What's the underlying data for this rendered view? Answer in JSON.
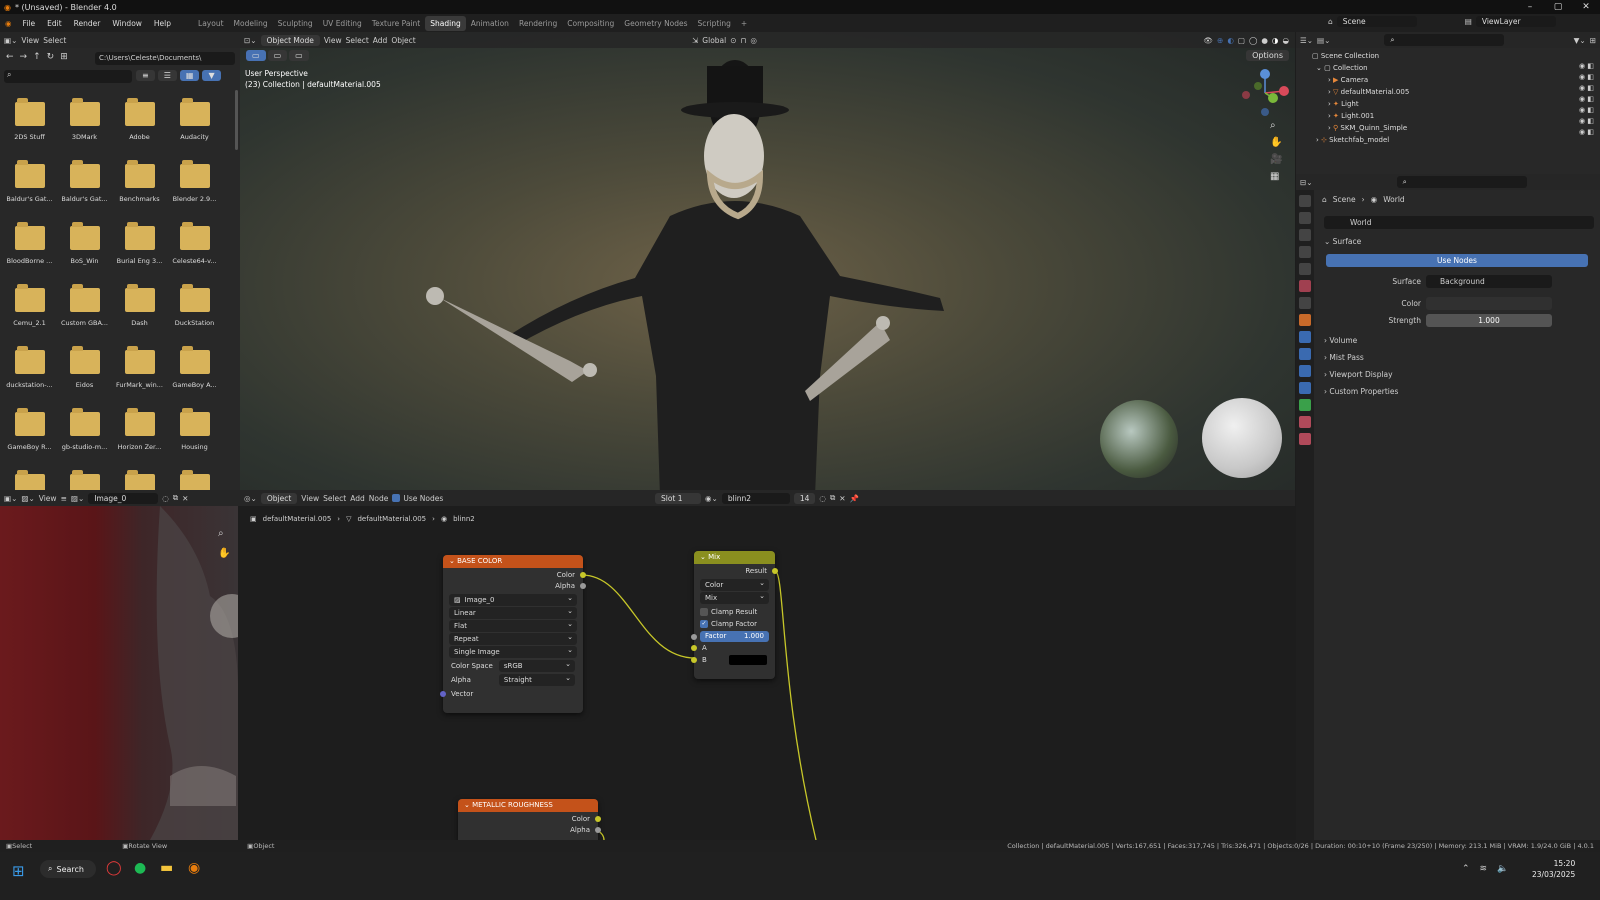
{
  "window": {
    "title": "* (Unsaved) - Blender 4.0"
  },
  "menu": {
    "items": [
      "File",
      "Edit",
      "Render",
      "Window",
      "Help"
    ]
  },
  "workspaces": [
    "Layout",
    "Modeling",
    "Sculpting",
    "UV Editing",
    "Texture Paint",
    "Shading",
    "Animation",
    "Rendering",
    "Compositing",
    "Geometry Nodes",
    "Scripting"
  ],
  "active_workspace": "Shading",
  "file_browser": {
    "view_label": "View",
    "select_label": "Select",
    "path": "C:\\Users\\Celeste\\Documents\\",
    "folders": [
      "2DS Stuff",
      "3DMark",
      "Adobe",
      "Audacity",
      "Baldur's Gat...",
      "Baldur's Gat...",
      "Benchmarks",
      "Blender 2.9...",
      "BloodBorne ...",
      "BoS_Win",
      "Burial Eng 3...",
      "Celeste64-v...",
      "Cemu_2.1",
      "Custom GBA...",
      "Dash",
      "DuckStation",
      "duckstation-...",
      "Eidos",
      "FurMark_win...",
      "GameBoy A...",
      "GameBoy R...",
      "gb-studio-m...",
      "Horizon Zer...",
      "Housing",
      "",
      "",
      "",
      ""
    ]
  },
  "viewport": {
    "mode": "Object Mode",
    "view": "View",
    "select": "Select",
    "add": "Add",
    "object": "Object",
    "orientation": "Global",
    "options": "Options",
    "perspective": "User Perspective",
    "collection_info": "(23) Collection | defaultMaterial.005"
  },
  "image_editor": {
    "view": "View",
    "image": "Image_0"
  },
  "node_editor": {
    "object_menu": "Object",
    "view": "View",
    "select": "Select",
    "add": "Add",
    "node": "Node",
    "use_nodes": "Use Nodes",
    "slot": "Slot 1",
    "material": "blinn2",
    "users": "14",
    "breadcrumb": [
      "defaultMaterial.005",
      "defaultMaterial.005",
      "blinn2"
    ],
    "base_color_node": {
      "title": "BASE COLOR",
      "outputs": [
        "Color",
        "Alpha"
      ],
      "image": "Image_0",
      "interpolation": "Linear",
      "projection": "Flat",
      "extension": "Repeat",
      "source": "Single Image",
      "color_space_label": "Color Space",
      "color_space": "sRGB",
      "alpha_label": "Alpha",
      "alpha": "Straight",
      "input": "Vector"
    },
    "mix_node": {
      "title": "Mix",
      "output": "Result",
      "data_type": "Color",
      "blend": "Mix",
      "clamp_result": "Clamp Result",
      "clamp_factor": "Clamp Factor",
      "factor_label": "Factor",
      "factor_value": "1.000",
      "input_a": "A",
      "input_b": "B"
    },
    "metallic_node": {
      "title": "METALLIC ROUGHNESS",
      "outputs": [
        "Color",
        "Alpha"
      ]
    }
  },
  "header_right": {
    "scene": "Scene",
    "view_layer": "ViewLayer"
  },
  "outliner": {
    "root": "Scene Collection",
    "collection": "Collection",
    "items": [
      "Camera",
      "defaultMaterial.005",
      "Light",
      "Light.001",
      "SKM_Quinn_Simple"
    ],
    "sketchfab": "Sketchfab_model"
  },
  "properties": {
    "breadcrumb": [
      "Scene",
      "World"
    ],
    "world_name": "World",
    "surface_panel": "Surface",
    "use_nodes": "Use Nodes",
    "surface_label": "Surface",
    "surface_value": "Background",
    "color_label": "Color",
    "strength_label": "Strength",
    "strength_value": "1.000",
    "panels": [
      "Volume",
      "Mist Pass",
      "Viewport Display",
      "Custom Properties"
    ]
  },
  "status": {
    "left1": "Select",
    "left2": "Rotate View",
    "left3": "Object",
    "right": "Collection | defaultMaterial.005 | Verts:167,651 | Faces:317,745 | Tris:326,471 | Objects:0/26 | Duration: 00:10+10 (Frame 23/250) | Memory: 213.1 MiB | VRAM: 1.9/24.0 GiB | 4.0.1"
  },
  "taskbar": {
    "search": "Search",
    "time": "15:20",
    "date": "23/03/2025"
  },
  "colors": {
    "accent": "#4772b3",
    "node_header_image": "#c4521a",
    "node_header_mix": "#8a8f1f",
    "socket_yellow": "#c7c729",
    "folder": "#d8b35a"
  }
}
